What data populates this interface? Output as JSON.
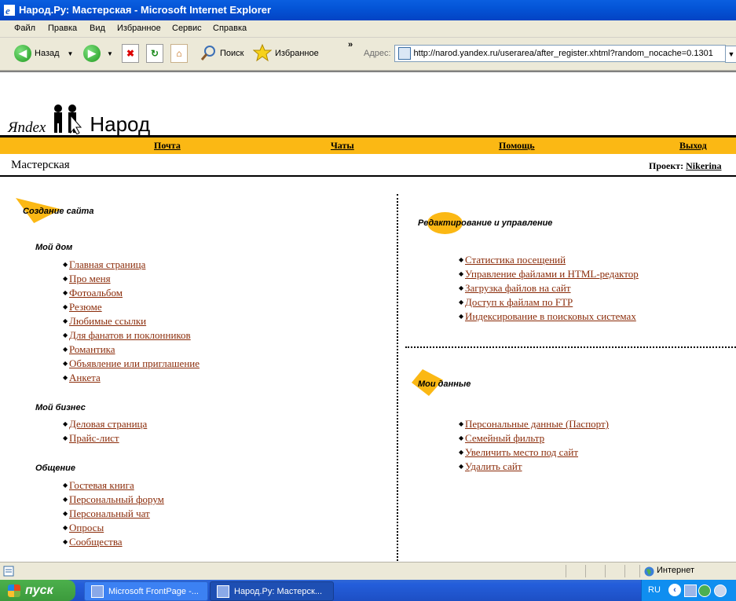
{
  "window": {
    "title": "Народ.Ру: Мастерская - Microsoft Internet Explorer",
    "menu": [
      "Файл",
      "Правка",
      "Вид",
      "Избранное",
      "Сервис",
      "Справка"
    ]
  },
  "toolbar": {
    "back_label": "Назад",
    "search_label": "Поиск",
    "favorites_label": "Избранное",
    "address_label": "Адрес:",
    "address_value": "http://narod.yandex.ru/userarea/after_register.xhtml?random_nocache=0.1301"
  },
  "page": {
    "logo": {
      "yandex": "Яndex",
      "narod": "Народ"
    },
    "nav": [
      "Почта",
      "Чаты",
      "Помощь",
      "Выход"
    ],
    "workshop_title": "Мастерская",
    "project_label": "Проект:",
    "project_name": "Nikerina",
    "left": {
      "section_title": "Создание сайта",
      "groups": [
        {
          "title": "Мой дом",
          "items": [
            "Главная страница",
            "Про меня",
            "Фотоальбом",
            "Резюме",
            "Любимые ссылки",
            "Для фанатов и поклонников",
            "Романтика",
            "Объявление или приглашение",
            "Анкета"
          ]
        },
        {
          "title": "Мой бизнес",
          "items": [
            "Деловая страница",
            "Прайс-лист"
          ]
        },
        {
          "title": "Общение",
          "items": [
            "Гостевая книга",
            "Персональный форум",
            "Персональный чат",
            "Опросы",
            "Сообщества"
          ]
        }
      ]
    },
    "right": {
      "edit_title": "Редактирование и управление",
      "edit_items": [
        "Статистика посещений",
        "Управление файлами и HTML-редактор",
        "Загрузка файлов на сайт",
        "Доступ к файлам по FTP",
        "Индексирование в поисковых системах"
      ],
      "data_title": "Мои данные",
      "data_items": [
        "Персональные данные (Паспорт)",
        "Семейный фильтр",
        "Увеличить место под сайт",
        "Удалить сайт"
      ]
    }
  },
  "statusbar": {
    "zone": "Интернет"
  },
  "taskbar": {
    "start": "пуск",
    "tasks": [
      "Microsoft FrontPage -...",
      "Народ.Ру: Мастерск..."
    ],
    "lang": "RU"
  },
  "colors": {
    "accent": "#fbb814",
    "link": "#8b2c0a"
  }
}
